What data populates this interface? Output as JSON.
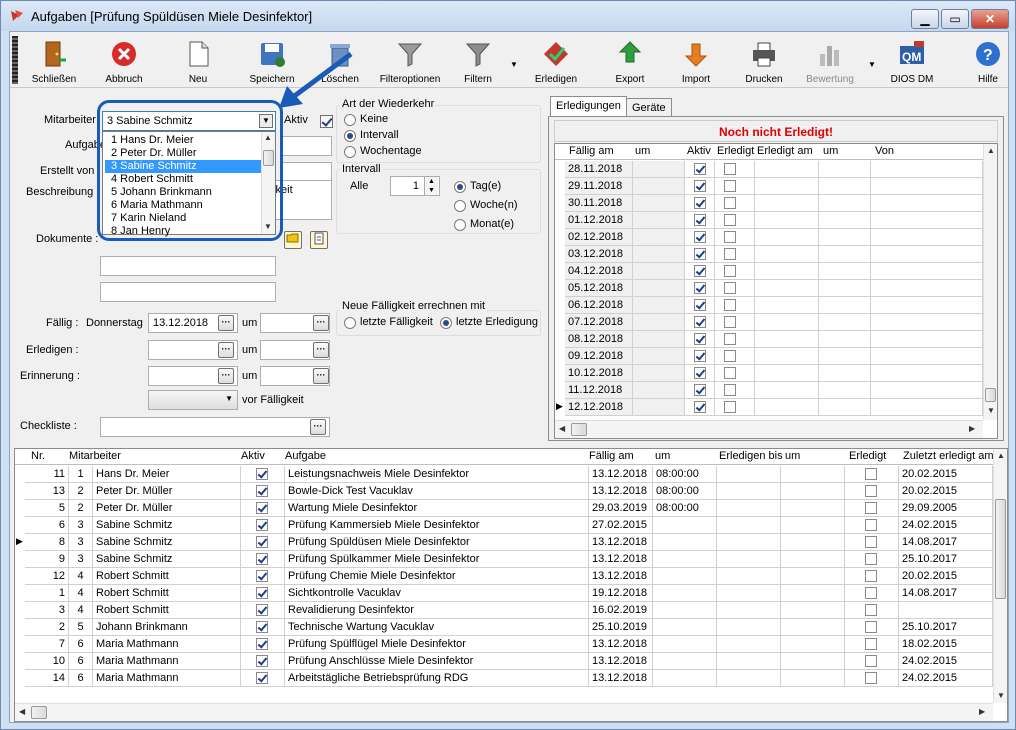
{
  "window": {
    "title": "Aufgaben [Prüfung Spüldüsen Miele Desinfektor]",
    "min": "▁",
    "max": "▭",
    "close": "✕"
  },
  "toolbar": {
    "buttons": [
      {
        "label": "Schließen",
        "icon": "door-exit-icon"
      },
      {
        "label": "Abbruch",
        "icon": "cancel-x-icon"
      },
      {
        "label": "Neu",
        "icon": "new-page-icon"
      },
      {
        "label": "Speichern",
        "icon": "save-disk-icon"
      },
      {
        "label": "Löschen",
        "icon": "trash-icon"
      },
      {
        "label": "Filteroptionen",
        "icon": "funnel-icon"
      },
      {
        "label": "Filtern",
        "icon": "filter-icon"
      },
      {
        "label": "Erledigen",
        "icon": "check-diamond-icon"
      },
      {
        "label": "Export",
        "icon": "export-arrow-icon"
      },
      {
        "label": "Import",
        "icon": "import-arrow-icon"
      },
      {
        "label": "Drucken",
        "icon": "printer-icon"
      },
      {
        "label": "Bewertung",
        "icon": "bar-chart-icon"
      },
      {
        "label": "DIOS DM",
        "icon": "dios-dm-icon"
      },
      {
        "label": "Hilfe",
        "icon": "help-icon"
      }
    ]
  },
  "form": {
    "mitarbeiter_label": "Mitarbeiter",
    "mitarbeiter_value": "3   Sabine Schmitz",
    "aktiv_label": "Aktiv",
    "aufgabe_label": "Aufgabe",
    "erstellt_label": "Erstellt von",
    "beschreibung_label": "Beschreibung",
    "beschreibung_value": "igkeit",
    "dokumente_label": "Dokumente :",
    "faellig_label": "Fällig :",
    "faellig_day": "Donnerstag",
    "faellig_date": "13.12.2018",
    "um_label": "um",
    "erledigen_label": "Erledigen :",
    "erinnerung_label": "Erinnerung :",
    "vor_faelligkeit": "vor Fälligkeit",
    "checkliste_label": "Checkliste :",
    "dropdown_items": [
      {
        "nr": "1",
        "name": "Hans Dr. Meier"
      },
      {
        "nr": "2",
        "name": "Peter Dr. Müller"
      },
      {
        "nr": "3",
        "name": "Sabine Schmitz"
      },
      {
        "nr": "4",
        "name": "Robert Schmitt"
      },
      {
        "nr": "5",
        "name": "Johann Brinkmann"
      },
      {
        "nr": "6",
        "name": "Maria Mathmann"
      },
      {
        "nr": "7",
        "name": "Karin Nieland"
      },
      {
        "nr": "8",
        "name": "Jan Henry"
      }
    ]
  },
  "wiederkehr": {
    "title": "Art der Wiederkehr",
    "options": [
      "Keine",
      "Intervall",
      "Wochentage"
    ],
    "selected": "Intervall",
    "intervall_title": "Intervall",
    "alle_label": "Alle",
    "alle_value": "1",
    "units": [
      "Tag(e)",
      "Woche(n)",
      "Monat(e)"
    ],
    "unit_selected": "Tag(e)",
    "neue_title": "Neue Fälligkeit errechnen mit",
    "neue_options": [
      "letzte Fälligkeit",
      "letzte Erledigung"
    ],
    "neue_selected": "letzte Erledigung"
  },
  "right_panel": {
    "tabs": [
      "Erledigungen",
      "Geräte"
    ],
    "active_tab": "Erledigungen",
    "status": "Noch nicht Erledigt!",
    "status_color": "#e00000",
    "columns": [
      "Fällig am",
      "um",
      "Aktiv",
      "Erledigt",
      "Erledigt am",
      "um",
      "Von"
    ],
    "rows": [
      {
        "date": "28.11.2018",
        "aktiv": true,
        "erledigt": false
      },
      {
        "date": "29.11.2018",
        "aktiv": true,
        "erledigt": false
      },
      {
        "date": "30.11.2018",
        "aktiv": true,
        "erledigt": false
      },
      {
        "date": "01.12.2018",
        "aktiv": true,
        "erledigt": false
      },
      {
        "date": "02.12.2018",
        "aktiv": true,
        "erledigt": false
      },
      {
        "date": "03.12.2018",
        "aktiv": true,
        "erledigt": false
      },
      {
        "date": "04.12.2018",
        "aktiv": true,
        "erledigt": false
      },
      {
        "date": "05.12.2018",
        "aktiv": true,
        "erledigt": false
      },
      {
        "date": "06.12.2018",
        "aktiv": true,
        "erledigt": false
      },
      {
        "date": "07.12.2018",
        "aktiv": true,
        "erledigt": false
      },
      {
        "date": "08.12.2018",
        "aktiv": true,
        "erledigt": false
      },
      {
        "date": "09.12.2018",
        "aktiv": true,
        "erledigt": false
      },
      {
        "date": "10.12.2018",
        "aktiv": true,
        "erledigt": false
      },
      {
        "date": "11.12.2018",
        "aktiv": true,
        "erledigt": false
      },
      {
        "date": "12.12.2018",
        "aktiv": true,
        "erledigt": false
      }
    ],
    "current_marker": "▶"
  },
  "bottom_grid": {
    "columns": [
      "Nr.",
      "Mitarbeiter",
      "Aktiv",
      "Aufgabe",
      "Fällig am",
      "um",
      "Erledigen bis",
      "um",
      "Erledigt",
      "Zuletzt erledigt am"
    ],
    "rows": [
      {
        "nr": "11",
        "ma": "1",
        "name": "Hans Dr. Meier",
        "aktiv": true,
        "aufgabe": "Leistungsnachweis Miele Desinfektor",
        "faellig": "13.12.2018",
        "um": "08:00:00",
        "erledigt": false,
        "zuletzt": "20.02.2015",
        "cur": false
      },
      {
        "nr": "13",
        "ma": "2",
        "name": "Peter Dr. Müller",
        "aktiv": true,
        "aufgabe": "Bowle-Dick Test Vacuklav",
        "faellig": "13.12.2018",
        "um": "08:00:00",
        "erledigt": false,
        "zuletzt": "20.02.2015",
        "cur": false
      },
      {
        "nr": "5",
        "ma": "2",
        "name": "Peter Dr. Müller",
        "aktiv": true,
        "aufgabe": "Wartung Miele Desinfektor",
        "faellig": "29.03.2019",
        "um": "08:00:00",
        "erledigt": false,
        "zuletzt": "29.09.2005",
        "cur": false
      },
      {
        "nr": "6",
        "ma": "3",
        "name": "Sabine Schmitz",
        "aktiv": true,
        "aufgabe": "Prüfung Kammersieb Miele Desinfektor",
        "faellig": "27.02.2015",
        "um": "",
        "erledigt": false,
        "zuletzt": "24.02.2015",
        "cur": false
      },
      {
        "nr": "8",
        "ma": "3",
        "name": "Sabine Schmitz",
        "aktiv": true,
        "aufgabe": "Prüfung Spüldüsen Miele Desinfektor",
        "faellig": "13.12.2018",
        "um": "",
        "erledigt": false,
        "zuletzt": "14.08.2017",
        "cur": true
      },
      {
        "nr": "9",
        "ma": "3",
        "name": "Sabine Schmitz",
        "aktiv": true,
        "aufgabe": "Prüfung Spülkammer Miele Desinfektor",
        "faellig": "13.12.2018",
        "um": "",
        "erledigt": false,
        "zuletzt": "25.10.2017",
        "cur": false
      },
      {
        "nr": "12",
        "ma": "4",
        "name": "Robert Schmitt",
        "aktiv": true,
        "aufgabe": "Prüfung Chemie Miele Desinfektor",
        "faellig": "13.12.2018",
        "um": "",
        "erledigt": false,
        "zuletzt": "20.02.2015",
        "cur": false
      },
      {
        "nr": "1",
        "ma": "4",
        "name": "Robert Schmitt",
        "aktiv": true,
        "aufgabe": "Sichtkontrolle Vacuklav",
        "faellig": "19.12.2018",
        "um": "",
        "erledigt": false,
        "zuletzt": "14.08.2017",
        "cur": false
      },
      {
        "nr": "3",
        "ma": "4",
        "name": "Robert Schmitt",
        "aktiv": true,
        "aufgabe": "Revalidierung Desinfektor",
        "faellig": "16.02.2019",
        "um": "",
        "erledigt": false,
        "zuletzt": "",
        "cur": false
      },
      {
        "nr": "2",
        "ma": "5",
        "name": "Johann Brinkmann",
        "aktiv": true,
        "aufgabe": "Technische Wartung Vacuklav",
        "faellig": "25.10.2019",
        "um": "",
        "erledigt": false,
        "zuletzt": "25.10.2017",
        "cur": false
      },
      {
        "nr": "7",
        "ma": "6",
        "name": "Maria Mathmann",
        "aktiv": true,
        "aufgabe": "Prüfung Spülflügel Miele Desinfektor",
        "faellig": "13.12.2018",
        "um": "",
        "erledigt": false,
        "zuletzt": "18.02.2015",
        "cur": false
      },
      {
        "nr": "10",
        "ma": "6",
        "name": "Maria Mathmann",
        "aktiv": true,
        "aufgabe": "Prüfung Anschlüsse Miele Desinfektor",
        "faellig": "13.12.2018",
        "um": "",
        "erledigt": false,
        "zuletzt": "24.02.2015",
        "cur": false
      },
      {
        "nr": "14",
        "ma": "6",
        "name": "Maria Mathmann",
        "aktiv": true,
        "aufgabe": "Arbeitstägliche Betriebsprüfung RDG",
        "faellig": "13.12.2018",
        "um": "",
        "erledigt": false,
        "zuletzt": "24.02.2015",
        "cur": false
      }
    ]
  }
}
